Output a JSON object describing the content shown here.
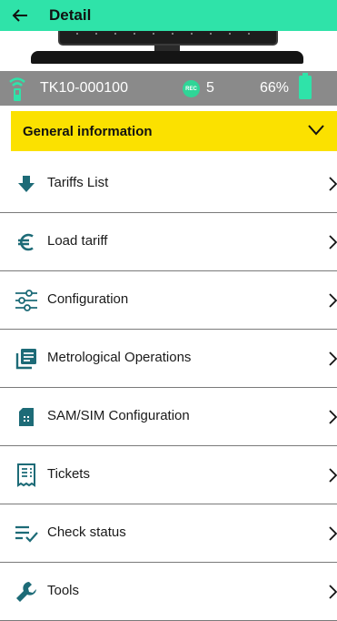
{
  "header": {
    "back_icon": "arrow-left-icon",
    "title": "Detail"
  },
  "device_image": "card-reader-device",
  "status": {
    "signal_icon": "wifi-signal-icon",
    "device_id": "TK10-000100",
    "rec_badge": "REC",
    "rec_count": "5",
    "battery_text": "66%",
    "battery_icon": "battery-icon"
  },
  "section": {
    "title": "General information",
    "chevron": "chevron-down-icon"
  },
  "colors": {
    "accent": "#2fe3a9",
    "header_yellow": "#fbe100",
    "status_gray": "#8a8a8a",
    "icon_teal": "#1d6b77"
  },
  "menu": [
    {
      "label": "Tariffs List",
      "icon": "download-arrow-icon"
    },
    {
      "label": "Load tariff",
      "icon": "euro-icon"
    },
    {
      "label": "Configuration",
      "icon": "sliders-icon"
    },
    {
      "label": "Metrological Operations",
      "icon": "library-books-icon"
    },
    {
      "label": "SAM/SIM Configuration",
      "icon": "sim-card-icon"
    },
    {
      "label": "Tickets",
      "icon": "receipt-icon"
    },
    {
      "label": "Check status",
      "icon": "checklist-icon"
    },
    {
      "label": "Tools",
      "icon": "wrench-icon"
    }
  ]
}
